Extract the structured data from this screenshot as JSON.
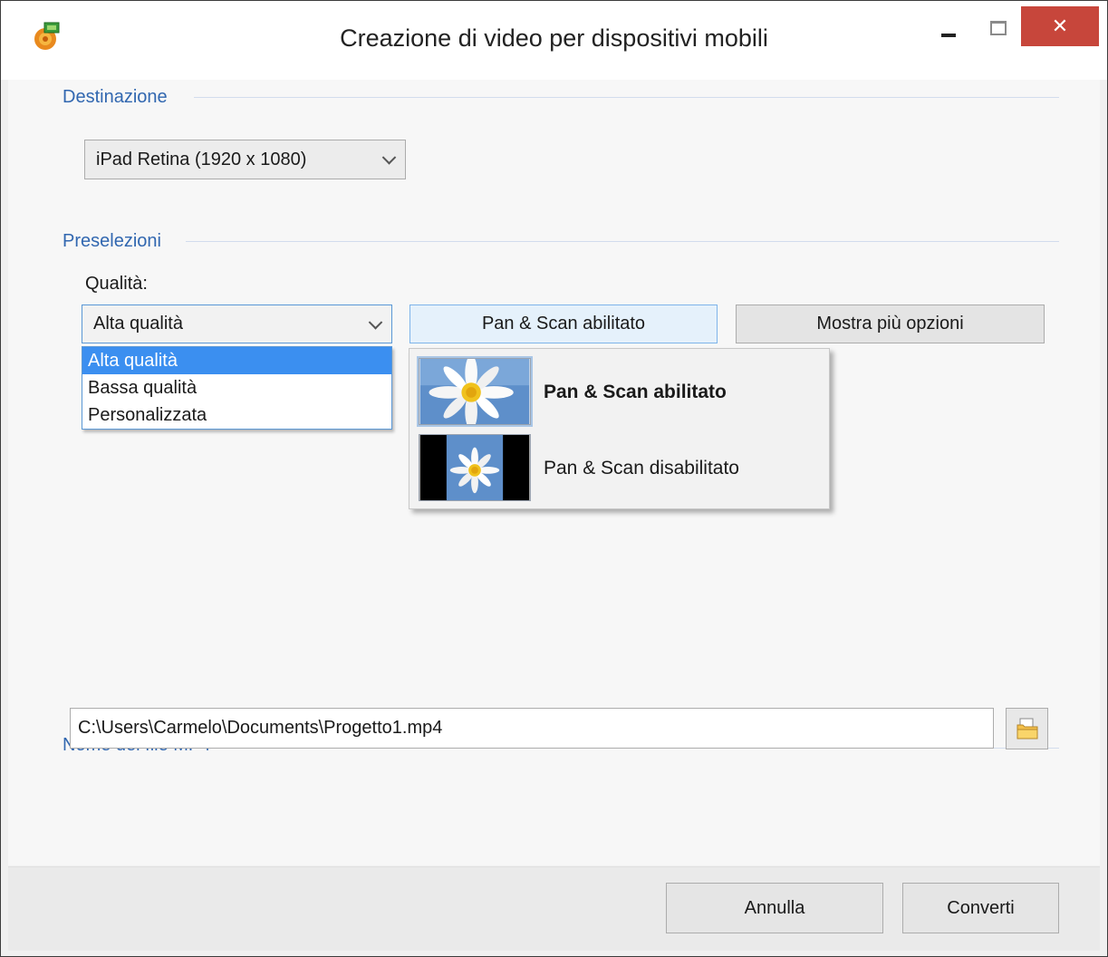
{
  "window": {
    "title": "Creazione di video per dispositivi mobili",
    "close_symbol": "✕",
    "icons": [
      "app-icon",
      "minimize-icon",
      "maximize-icon",
      "close-icon"
    ]
  },
  "destination": {
    "group_title": "Destinazione",
    "device_selected": "iPad Retina (1920 x 1080)"
  },
  "presets": {
    "group_title": "Preselezioni",
    "quality_label": "Qualità:",
    "quality_selected": "Alta qualità",
    "quality_options": [
      "Alta qualità",
      "Bassa qualità",
      "Personalizzata"
    ],
    "pan_scan_button": "Pan & Scan abilitato",
    "more_options_button": "Mostra più opzioni",
    "pan_scan_menu": [
      {
        "label": "Pan & Scan abilitato",
        "active": true
      },
      {
        "label": "Pan & Scan disabilitato",
        "active": false
      }
    ]
  },
  "output": {
    "group_title": "Nome del file MP4",
    "file_path": "C:\\Users\\Carmelo\\Documents\\Progetto1.mp4"
  },
  "footer": {
    "cancel_label": "Annulla",
    "convert_label": "Converti"
  },
  "colors": {
    "accent": "#3167b0",
    "selection": "#3b8ff0",
    "close_button": "#c7463b"
  }
}
